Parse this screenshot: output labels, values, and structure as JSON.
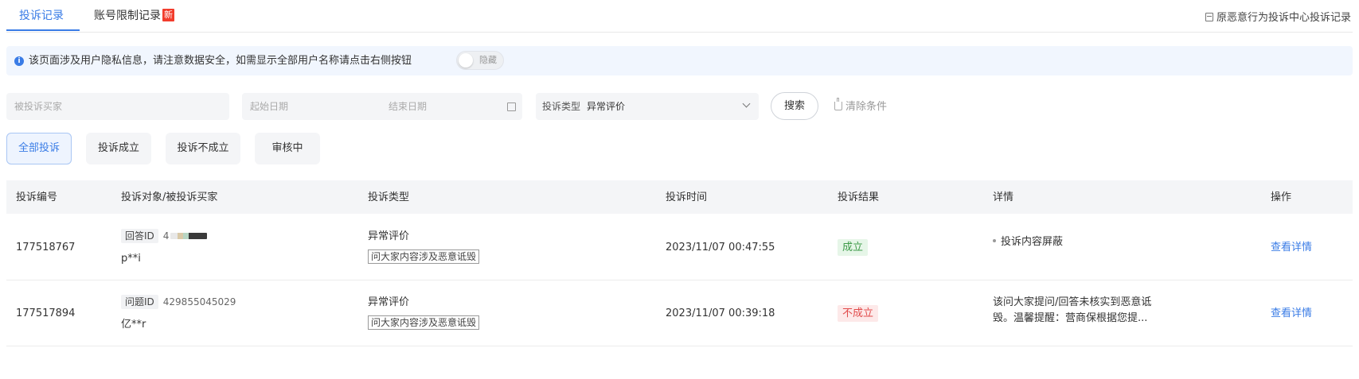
{
  "tabs": [
    {
      "label": "投诉记录",
      "active": true
    },
    {
      "label": "账号限制记录",
      "badge": "新",
      "active": false
    }
  ],
  "top_link": "原恶意行为投诉中心投诉记录",
  "notice": {
    "text": "该页面涉及用户隐私信息，请注意数据安全，如需显示全部用户名称请点击右侧按钮",
    "toggle_label": "隐藏"
  },
  "filters": {
    "buyer_placeholder": "被投诉买家",
    "start_date_placeholder": "起始日期",
    "end_date_placeholder": "结束日期",
    "type_label": "投诉类型",
    "type_value": "异常评价",
    "search_label": "搜索",
    "clear_label": "清除条件"
  },
  "status_chips": [
    "全部投诉",
    "投诉成立",
    "投诉不成立",
    "审核中"
  ],
  "table": {
    "headers": [
      "投诉编号",
      "投诉对象/被投诉买家",
      "投诉类型",
      "投诉时间",
      "投诉结果",
      "详情",
      "操作"
    ],
    "rows": [
      {
        "id": "177518767",
        "target_tag": "回答ID",
        "target_id": "4",
        "buyer": "p**i",
        "type": "异常评价",
        "type_tag": "问大家内容涉及恶意诋毁",
        "time": "2023/11/07 00:47:55",
        "result": "成立",
        "detail_line1": "投诉内容屏蔽",
        "detail_line2": "",
        "action": "查看详情"
      },
      {
        "id": "177517894",
        "target_tag": "问题ID",
        "target_id": "429855045029",
        "buyer": "亿**r",
        "type": "异常评价",
        "type_tag": "问大家内容涉及恶意诋毁",
        "time": "2023/11/07 00:39:18",
        "result": "不成立",
        "detail_line1": "该问大家提问/回答未核实到恶意诋",
        "detail_line2": "毁。温馨提醒：营商保根据您提...",
        "action": "查看详情"
      }
    ]
  },
  "colors": {
    "accent": "#3a7ce6",
    "success": "#3f9b4a",
    "danger": "#e14b4b",
    "badge": "#f23c2c"
  }
}
